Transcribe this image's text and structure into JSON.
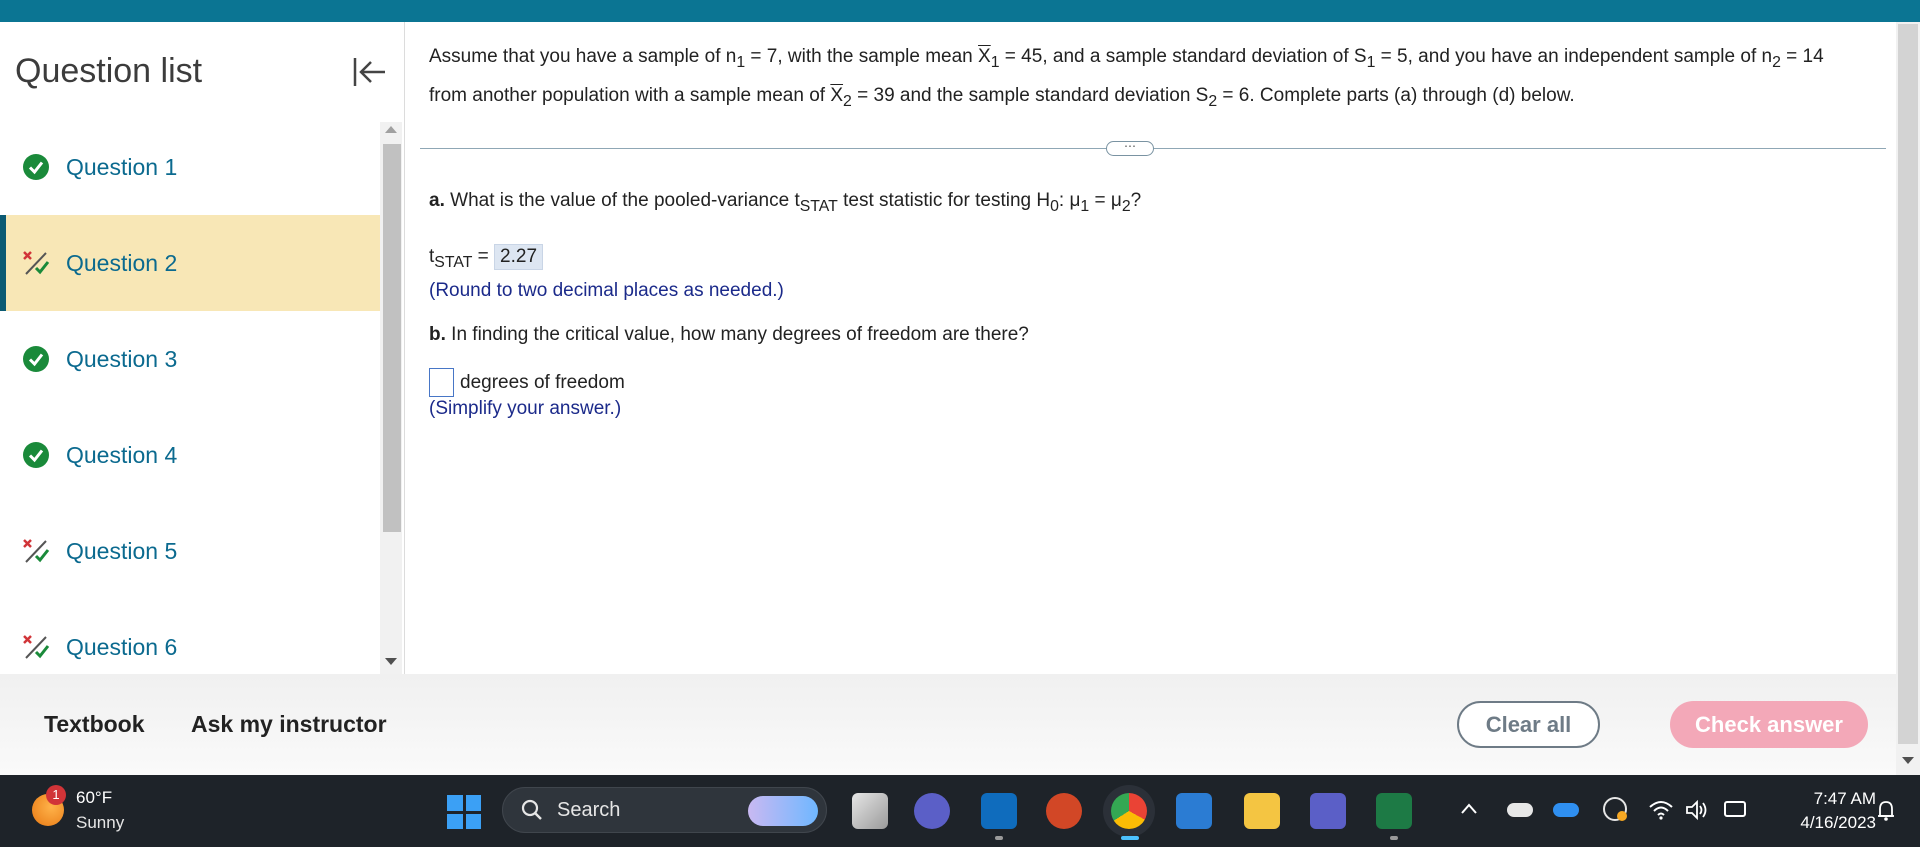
{
  "sidebar": {
    "title": "Question list",
    "questions": [
      {
        "label": "Question 1",
        "status": "correct"
      },
      {
        "label": "Question 2",
        "status": "partial",
        "active": true
      },
      {
        "label": "Question 3",
        "status": "correct"
      },
      {
        "label": "Question 4",
        "status": "correct"
      },
      {
        "label": "Question 5",
        "status": "partial"
      },
      {
        "label": "Question 6",
        "status": "partial"
      }
    ]
  },
  "problem": {
    "intro_1": "Assume that you have a sample of n",
    "sub_1": "1",
    "intro_2": " = 7, with the sample mean ",
    "xbar": "X",
    "sub_2": "1",
    "intro_3": " = 45, and a sample standard deviation of S",
    "sub_3": "1",
    "intro_4": " = 5, and you have an independent sample of n",
    "sub_4": "2",
    "intro_5": " = 14",
    "line2_1": "from another population with a sample mean of ",
    "xbar2": "X",
    "sub_5": "2",
    "line2_2": " = 39 and the sample standard deviation S",
    "sub_6": "2",
    "line2_3": " = 6. Complete parts (a) through (d) below.",
    "more_label": "⋯"
  },
  "part_a": {
    "letter": "a.",
    "text_1": " What is the value of the pooled-variance t",
    "sub_stat": "STAT",
    "text_2": " test statistic for testing H",
    "sub_0": "0",
    "text_3": ": μ",
    "sub_mu1": "1",
    "text_4": " = μ",
    "sub_mu2": "2",
    "text_5": "?",
    "answer_prefix": "t",
    "answer_sub": "STAT",
    "answer_eq": " = ",
    "answer_value": "2.27",
    "hint": "(Round to two decimal places as needed.)"
  },
  "part_b": {
    "letter": "b.",
    "text": " In finding the critical value, how many degrees of freedom are there?",
    "answer_value": "",
    "suffix": "degrees of freedom",
    "hint": "(Simplify your answer.)"
  },
  "footer": {
    "textbook": "Textbook",
    "ask": "Ask my instructor",
    "clear": "Clear all",
    "check": "Check answer"
  },
  "taskbar": {
    "weather_badge": "1",
    "temperature": "60°F",
    "condition": "Sunny",
    "search": "Search",
    "time": "7:47 AM",
    "date": "4/16/2023"
  },
  "colors": {
    "header_teal": "#0b7593",
    "active_row": "#f8e7b6",
    "link_blue": "#0b6a8f",
    "correct_green": "#1a8a3a",
    "check_button_pink": "#f3a8b8"
  }
}
